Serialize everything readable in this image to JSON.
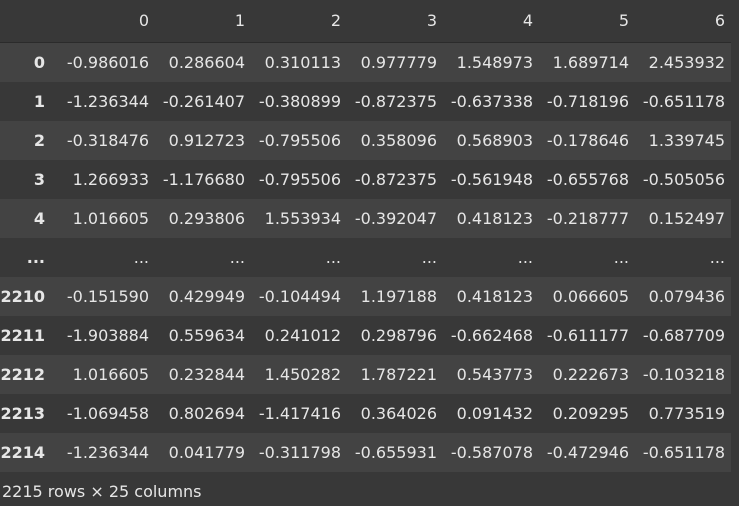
{
  "table": {
    "columns": [
      "",
      "0",
      "1",
      "2",
      "3",
      "4",
      "5",
      "6"
    ],
    "rows": [
      {
        "index": "0",
        "values": [
          "-0.986016",
          "0.286604",
          "0.310113",
          "0.977779",
          "1.548973",
          "1.689714",
          "2.453932"
        ]
      },
      {
        "index": "1",
        "values": [
          "-1.236344",
          "-0.261407",
          "-0.380899",
          "-0.872375",
          "-0.637338",
          "-0.718196",
          "-0.651178"
        ]
      },
      {
        "index": "2",
        "values": [
          "-0.318476",
          "0.912723",
          "-0.795506",
          "0.358096",
          "0.568903",
          "-0.178646",
          "1.339745"
        ]
      },
      {
        "index": "3",
        "values": [
          "1.266933",
          "-1.176680",
          "-0.795506",
          "-0.872375",
          "-0.561948",
          "-0.655768",
          "-0.505056"
        ]
      },
      {
        "index": "4",
        "values": [
          "1.016605",
          "0.293806",
          "1.553934",
          "-0.392047",
          "0.418123",
          "-0.218777",
          "0.152497"
        ]
      },
      {
        "index": "...",
        "values": [
          "...",
          "...",
          "...",
          "...",
          "...",
          "...",
          "..."
        ]
      },
      {
        "index": "2210",
        "values": [
          "-0.151590",
          "0.429949",
          "-0.104494",
          "1.197188",
          "0.418123",
          "0.066605",
          "0.079436"
        ]
      },
      {
        "index": "2211",
        "values": [
          "-1.903884",
          "0.559634",
          "0.241012",
          "0.298796",
          "-0.662468",
          "-0.611177",
          "-0.687709"
        ]
      },
      {
        "index": "2212",
        "values": [
          "1.016605",
          "0.232844",
          "1.450282",
          "1.787221",
          "0.543773",
          "0.222673",
          "-0.103218"
        ]
      },
      {
        "index": "2213",
        "values": [
          "-1.069458",
          "0.802694",
          "-1.417416",
          "0.364026",
          "0.091432",
          "0.209295",
          "0.773519"
        ]
      },
      {
        "index": "2214",
        "values": [
          "-1.236344",
          "0.041779",
          "-0.311798",
          "-0.655931",
          "-0.587078",
          "-0.472946",
          "-0.651178"
        ]
      }
    ]
  },
  "footer": {
    "shape_text": "2215 rows × 25 columns"
  }
}
